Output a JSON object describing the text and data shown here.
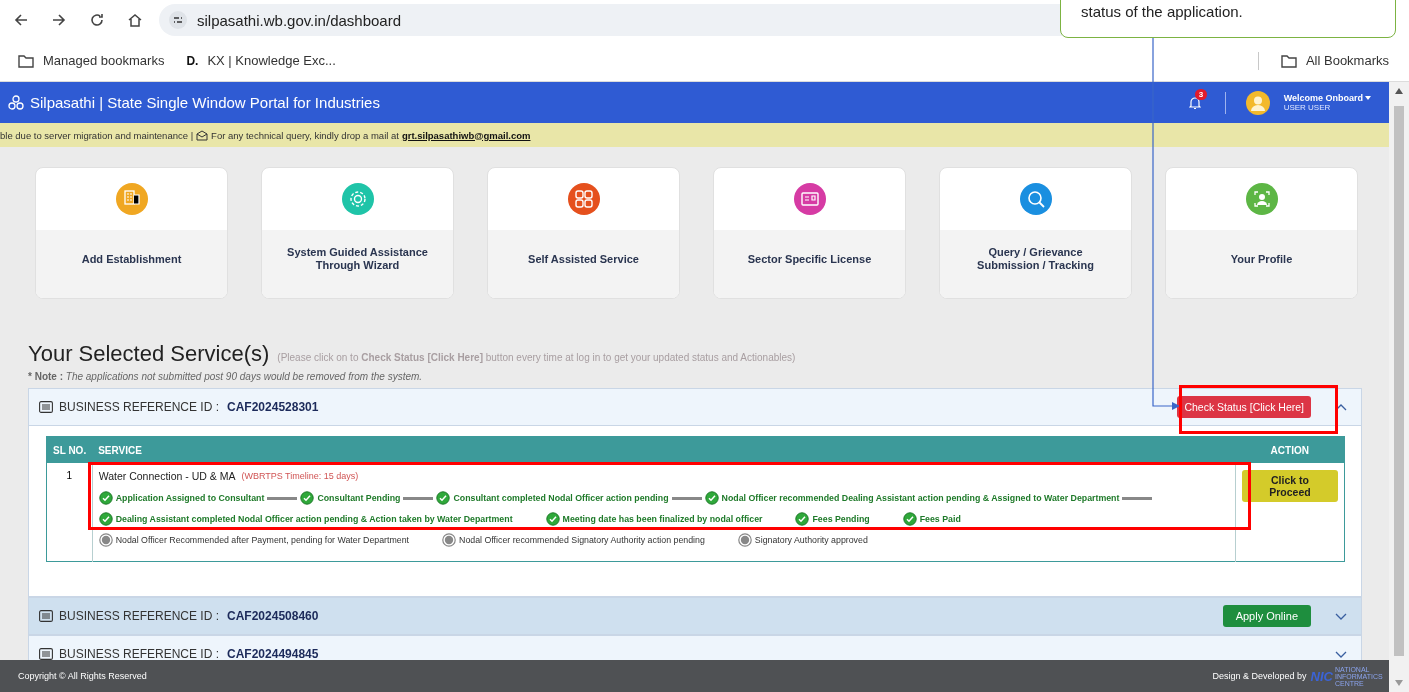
{
  "browser": {
    "url": "silpasathi.wb.gov.in/dashboard",
    "bookmarks": [
      {
        "label": "Managed bookmarks",
        "kind": "folder"
      },
      {
        "label": "KX | Knowledge Exc...",
        "kind": "site",
        "badge": "D."
      }
    ],
    "all_bookmarks": "All Bookmarks"
  },
  "header": {
    "title": "Silpasathi | State Single Window Portal for Industries",
    "notifications": "3",
    "user_greeting": "Welcome Onboard",
    "user_name": "USER USER"
  },
  "notice": {
    "text": "ble due to server migration and maintenance | ",
    "text2": "For any technical query, kindly drop a mail at",
    "email": "grt.silpasathiwb@gmail.com"
  },
  "tiles": [
    {
      "label": "Add Establishment",
      "color": "#f0a722"
    },
    {
      "label": "System Guided Assistance Through Wizard",
      "color": "#1fc4a8"
    },
    {
      "label": "Self Assisted Service",
      "color": "#e5501d"
    },
    {
      "label": "Sector Specific License",
      "color": "#d63ba4"
    },
    {
      "label": "Query / Grievance Submission / Tracking",
      "color": "#1a8fe0"
    },
    {
      "label": "Your Profile",
      "color": "#5db645"
    }
  ],
  "section": {
    "title": "Your Selected Service(s)",
    "hint": "(Please click on to **Check Status [Click Here]** button every time at log in to get your updated status and Actionables)",
    "note": "*** Note :** *The applications not submitted post 90 days would be removed from the system.*"
  },
  "references": [
    {
      "label": "BUSINESS REFERENCE ID :",
      "id": "CAF2024528301",
      "expanded": true,
      "highlighted": false,
      "action": {
        "label": "Check Status [Click Here]",
        "kind": "danger"
      },
      "table": {
        "columns": [
          "SL NO.",
          "SERVICE",
          "ACTION"
        ],
        "rows": [
          {
            "sl": "1",
            "service": "Water Connection - UD & MA",
            "timeline": "(WBRTPS Timeline: 15 days)",
            "action": "Click to Proceed",
            "step_rows": [
              [
                {
                  "label": "Application Assigned to Consultant",
                  "done": true,
                  "connector": true
                },
                {
                  "label": "Consultant Pending",
                  "done": true,
                  "connector": true
                },
                {
                  "label": "Consultant completed Nodal Officer action pending",
                  "done": true,
                  "connector": true
                },
                {
                  "label": "Nodal Officer recommended Dealing Assistant action pending & Assigned to Water Department",
                  "done": true,
                  "connector": true
                }
              ],
              [
                {
                  "label": "Dealing Assistant completed Nodal Officer action pending & Action taken by Water Department",
                  "done": true,
                  "connector": false
                },
                {
                  "label": "Meeting date has been finalized by nodal officer",
                  "done": true,
                  "connector": false
                },
                {
                  "label": "Fees Pending",
                  "done": true,
                  "connector": false
                },
                {
                  "label": "Fees Paid",
                  "done": true,
                  "connector": false
                }
              ],
              [
                {
                  "label": "Nodal Officer Recommended after Payment, pending for Water Department",
                  "done": false,
                  "connector": false
                },
                {
                  "label": "Nodal Officer recommended Signatory Authority action pending",
                  "done": false,
                  "connector": false
                },
                {
                  "label": "Signatory Authority approved",
                  "done": false,
                  "connector": false
                }
              ]
            ]
          }
        ]
      }
    },
    {
      "label": "BUSINESS REFERENCE ID :",
      "id": "CAF2024508460",
      "expanded": false,
      "highlighted": true,
      "action": {
        "label": "Apply Online",
        "kind": "success"
      }
    },
    {
      "label": "BUSINESS REFERENCE ID :",
      "id": "CAF2024494845",
      "expanded": false,
      "highlighted": false
    }
  ],
  "footer": {
    "copyright": "Copyright © All Rights Reserved",
    "credit": "Design & Developed by",
    "logo": "NIC",
    "logo_caption": "NATIONAL INFORMATICS CENTRE"
  },
  "annotation": {
    "callout": "status of the application."
  }
}
